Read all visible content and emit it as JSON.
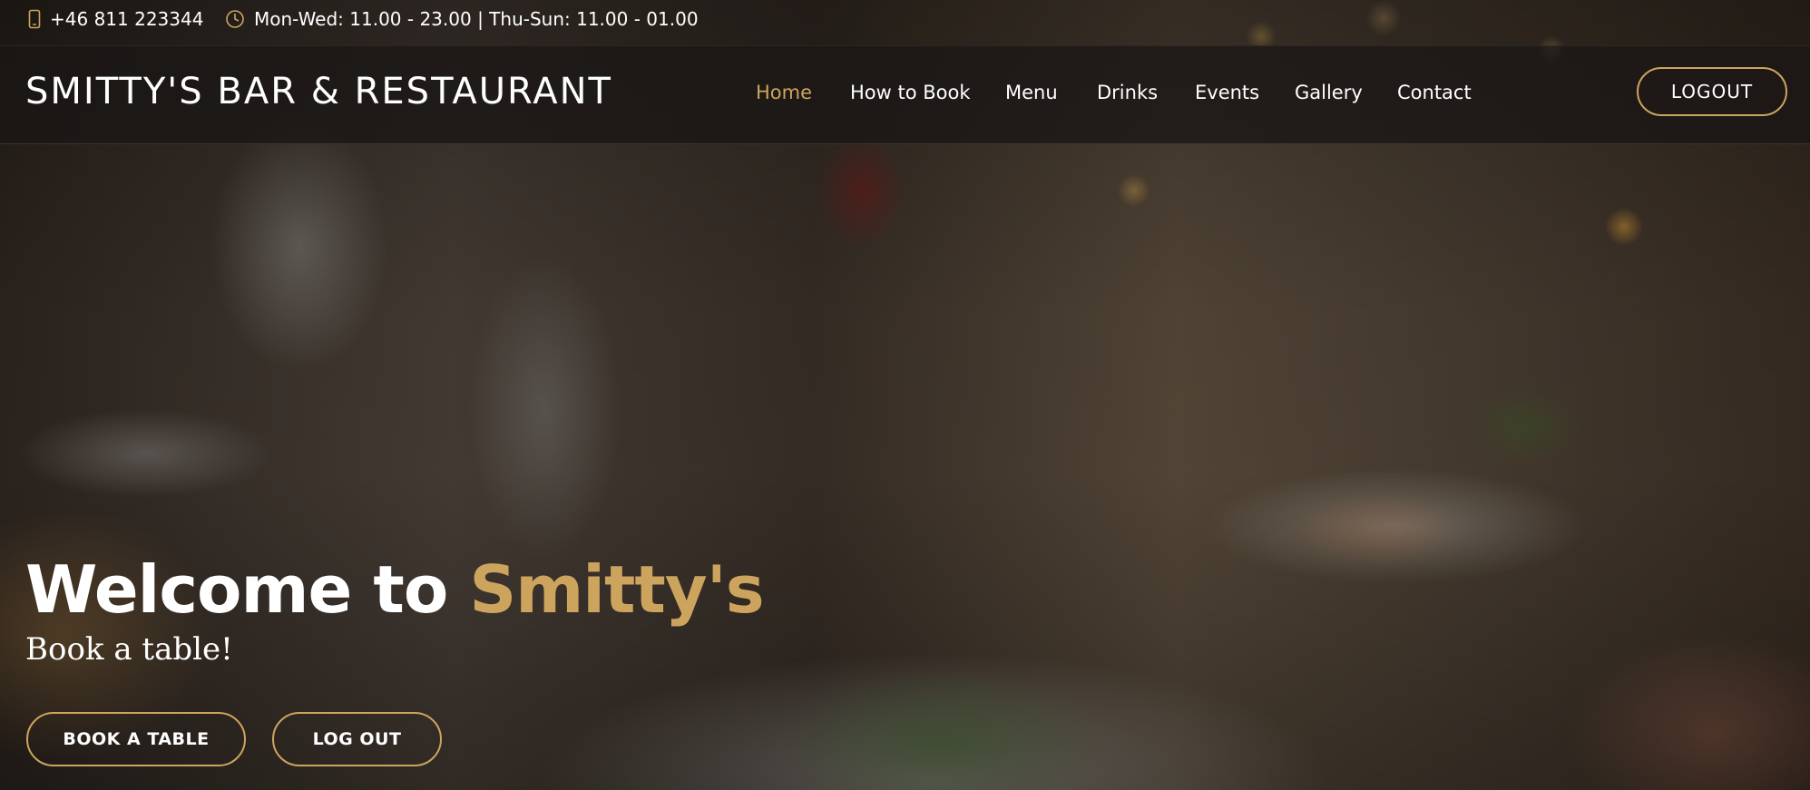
{
  "topbar": {
    "phone_icon": "phone-icon",
    "phone": "+46 811 223344",
    "clock_icon": "clock-icon",
    "hours": "Mon-Wed: 11.00 - 23.00 | Thu-Sun: 11.00 - 01.00"
  },
  "header": {
    "logo": "SMITTY'S BAR & RESTAURANT",
    "nav": [
      "Home",
      "How to Book",
      "Menu",
      "Drinks",
      "Events",
      "Gallery",
      "Contact"
    ],
    "active_nav": "Home",
    "logout_label": "LOGOUT"
  },
  "hero": {
    "welcome_prefix": "Welcome to",
    "welcome_accent": "Smitty's",
    "subtitle": "Book a table!",
    "book_button": "BOOK A TABLE",
    "logout_button": "LOG OUT"
  },
  "colors": {
    "accent": "#cda45e",
    "text": "#ffffff",
    "header_bg": "#19161480"
  }
}
